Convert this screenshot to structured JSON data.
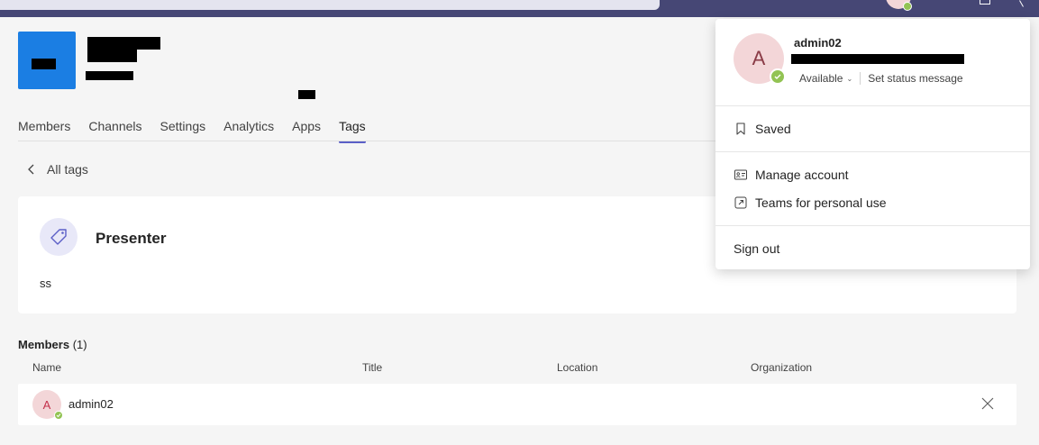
{
  "team": {
    "tabs": [
      {
        "label": "Members"
      },
      {
        "label": "Channels"
      },
      {
        "label": "Settings"
      },
      {
        "label": "Analytics"
      },
      {
        "label": "Apps"
      },
      {
        "label": "Tags"
      }
    ],
    "active_tab": "Tags"
  },
  "back_link": {
    "label": "All tags"
  },
  "tag": {
    "name": "Presenter",
    "description": "ss"
  },
  "members": {
    "heading": "Members",
    "count": "(1)",
    "columns": [
      "Name",
      "Title",
      "Location",
      "Organization"
    ],
    "rows": [
      {
        "initial": "A",
        "name": "admin02"
      }
    ]
  },
  "account_menu": {
    "initial": "A",
    "name": "admin02",
    "status": "Available",
    "set_status": "Set status message",
    "items": {
      "saved": "Saved",
      "manage_account": "Manage account",
      "personal_use": "Teams for personal use",
      "sign_out": "Sign out"
    }
  },
  "colors": {
    "brand": "#464775",
    "accent": "#5b5fc7",
    "team_tile": "#1b7ee3",
    "available": "#92c353"
  }
}
